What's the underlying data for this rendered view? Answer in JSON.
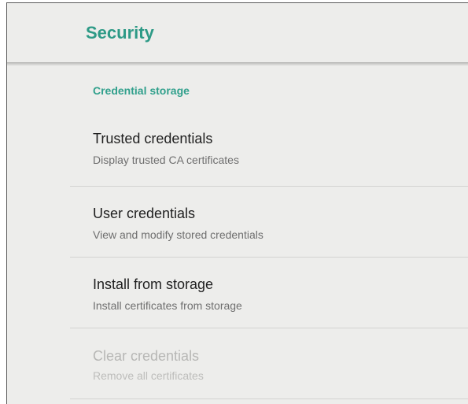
{
  "header": {
    "title": "Security",
    "accent_color": "#2d9a86"
  },
  "section": {
    "label": "Credential storage"
  },
  "items": [
    {
      "title": "Trusted credentials",
      "summary": "Display trusted CA certificates",
      "enabled": true
    },
    {
      "title": "User credentials",
      "summary": "View and modify stored credentials",
      "enabled": true
    },
    {
      "title": "Install from storage",
      "summary": "Install certificates from storage",
      "enabled": true
    },
    {
      "title": "Clear credentials",
      "summary": "Remove all certificates",
      "enabled": false
    }
  ]
}
